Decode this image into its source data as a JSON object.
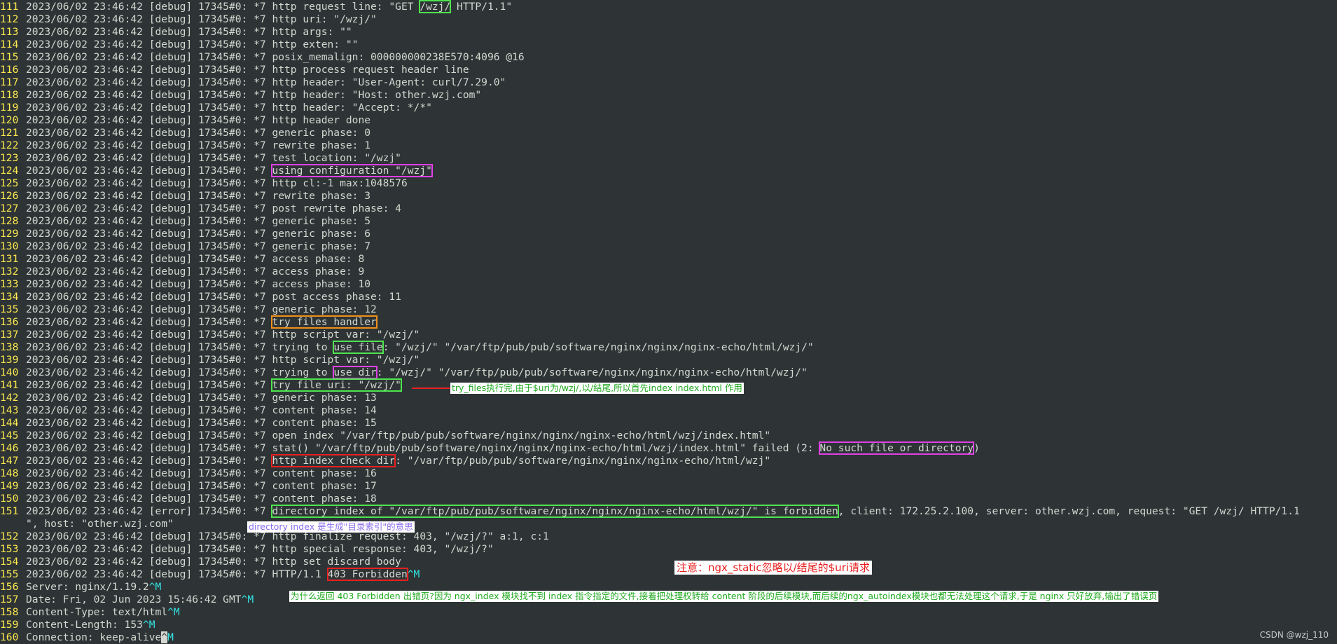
{
  "terminal": {
    "l111": {
      "num": "111",
      "a": "2023/06/02 23:46:42 [debug] 17345#0: *7 http request line: \"GET ",
      "b": "/wzj/",
      "c": " HTTP/1.1\""
    },
    "l112": {
      "num": "112",
      "text": "2023/06/02 23:46:42 [debug] 17345#0: *7 http uri: \"/wzj/\""
    },
    "l113": {
      "num": "113",
      "text": "2023/06/02 23:46:42 [debug] 17345#0: *7 http args: \"\""
    },
    "l114": {
      "num": "114",
      "text": "2023/06/02 23:46:42 [debug] 17345#0: *7 http exten: \"\""
    },
    "l115": {
      "num": "115",
      "text": "2023/06/02 23:46:42 [debug] 17345#0: *7 posix_memalign: 000000000238E570:4096 @16"
    },
    "l116": {
      "num": "116",
      "text": "2023/06/02 23:46:42 [debug] 17345#0: *7 http process request header line"
    },
    "l117": {
      "num": "117",
      "text": "2023/06/02 23:46:42 [debug] 17345#0: *7 http header: \"User-Agent: curl/7.29.0\""
    },
    "l118": {
      "num": "118",
      "text": "2023/06/02 23:46:42 [debug] 17345#0: *7 http header: \"Host: other.wzj.com\""
    },
    "l119": {
      "num": "119",
      "text": "2023/06/02 23:46:42 [debug] 17345#0: *7 http header: \"Accept: */*\""
    },
    "l120": {
      "num": "120",
      "text": "2023/06/02 23:46:42 [debug] 17345#0: *7 http header done"
    },
    "l121": {
      "num": "121",
      "text": "2023/06/02 23:46:42 [debug] 17345#0: *7 generic phase: 0"
    },
    "l122": {
      "num": "122",
      "text": "2023/06/02 23:46:42 [debug] 17345#0: *7 rewrite phase: 1"
    },
    "l123": {
      "num": "123",
      "text": "2023/06/02 23:46:42 [debug] 17345#0: *7 test location: \"/wzj\""
    },
    "l124": {
      "num": "124",
      "a": "2023/06/02 23:46:42 [debug] 17345#0: *7 ",
      "b": "using configuration \"/wzj\""
    },
    "l125": {
      "num": "125",
      "text": "2023/06/02 23:46:42 [debug] 17345#0: *7 http cl:-1 max:1048576"
    },
    "l126": {
      "num": "126",
      "text": "2023/06/02 23:46:42 [debug] 17345#0: *7 rewrite phase: 3"
    },
    "l127": {
      "num": "127",
      "text": "2023/06/02 23:46:42 [debug] 17345#0: *7 post rewrite phase: 4"
    },
    "l128": {
      "num": "128",
      "text": "2023/06/02 23:46:42 [debug] 17345#0: *7 generic phase: 5"
    },
    "l129": {
      "num": "129",
      "text": "2023/06/02 23:46:42 [debug] 17345#0: *7 generic phase: 6"
    },
    "l130": {
      "num": "130",
      "text": "2023/06/02 23:46:42 [debug] 17345#0: *7 generic phase: 7"
    },
    "l131": {
      "num": "131",
      "text": "2023/06/02 23:46:42 [debug] 17345#0: *7 access phase: 8"
    },
    "l132": {
      "num": "132",
      "text": "2023/06/02 23:46:42 [debug] 17345#0: *7 access phase: 9"
    },
    "l133": {
      "num": "133",
      "text": "2023/06/02 23:46:42 [debug] 17345#0: *7 access phase: 10"
    },
    "l134": {
      "num": "134",
      "text": "2023/06/02 23:46:42 [debug] 17345#0: *7 post access phase: 11"
    },
    "l135": {
      "num": "135",
      "text": "2023/06/02 23:46:42 [debug] 17345#0: *7 generic phase: 12"
    },
    "l136": {
      "num": "136",
      "a": "2023/06/02 23:46:42 [debug] 17345#0: *7 ",
      "b": "try files handler"
    },
    "l137": {
      "num": "137",
      "text": "2023/06/02 23:46:42 [debug] 17345#0: *7 http script var: \"/wzj/\""
    },
    "l138": {
      "num": "138",
      "a": "2023/06/02 23:46:42 [debug] 17345#0: *7 trying to ",
      "b": "use file",
      "c": ": \"/wzj/\" \"/var/ftp/pub/pub/software/nginx/nginx/nginx-echo/html/wzj/\""
    },
    "l139": {
      "num": "139",
      "text": "2023/06/02 23:46:42 [debug] 17345#0: *7 http script var: \"/wzj/\""
    },
    "l140": {
      "num": "140",
      "a": "2023/06/02 23:46:42 [debug] 17345#0: *7 trying to ",
      "b": "use dir",
      "c": ": \"/wzj/\" \"/var/ftp/pub/pub/software/nginx/nginx/nginx-echo/html/wzj/\""
    },
    "l141": {
      "num": "141",
      "a": "2023/06/02 23:46:42 [debug] 17345#0: *7 ",
      "b": "try file uri: \"/wzj/\""
    },
    "l142": {
      "num": "142",
      "text": "2023/06/02 23:46:42 [debug] 17345#0: *7 generic phase: 13"
    },
    "l143": {
      "num": "143",
      "text": "2023/06/02 23:46:42 [debug] 17345#0: *7 content phase: 14"
    },
    "l144": {
      "num": "144",
      "text": "2023/06/02 23:46:42 [debug] 17345#0: *7 content phase: 15"
    },
    "l145": {
      "num": "145",
      "text": "2023/06/02 23:46:42 [debug] 17345#0: *7 open index \"/var/ftp/pub/pub/software/nginx/nginx/nginx-echo/html/wzj/index.html\""
    },
    "l146": {
      "num": "146",
      "a": "2023/06/02 23:46:42 [debug] 17345#0: *7 stat() \"/var/ftp/pub/pub/software/nginx/nginx/nginx-echo/html/wzj/index.html\" failed (2: ",
      "b": "No such file or directory",
      "c": ")"
    },
    "l147": {
      "num": "147",
      "a": "2023/06/02 23:46:42 [debug] 17345#0: *7 ",
      "b": "http index check dir",
      "c": ": \"/var/ftp/pub/pub/software/nginx/nginx/nginx-echo/html/wzj\""
    },
    "l148": {
      "num": "148",
      "text": "2023/06/02 23:46:42 [debug] 17345#0: *7 content phase: 16"
    },
    "l149": {
      "num": "149",
      "text": "2023/06/02 23:46:42 [debug] 17345#0: *7 content phase: 17"
    },
    "l150": {
      "num": "150",
      "text": "2023/06/02 23:46:42 [debug] 17345#0: *7 content phase: 18"
    },
    "l151": {
      "num": "151",
      "a": "2023/06/02 23:46:42 [error] 17345#0: *7 ",
      "b": "directory index of \"/var/ftp/pub/pub/software/nginx/nginx/nginx-echo/html/wzj/\" is forbidden",
      "c": ", client: 172.25.2.100, server: other.wzj.com, request: \"GET /wzj/ HTTP/1.1",
      "d": "\", host: \"other.wzj.com\""
    },
    "l152": {
      "num": "152",
      "text": "2023/06/02 23:46:42 [debug] 17345#0: *7 http finalize request: 403, \"/wzj/?\" a:1, c:1"
    },
    "l153": {
      "num": "153",
      "text": "2023/06/02 23:46:42 [debug] 17345#0: *7 http special response: 403, \"/wzj/?\""
    },
    "l154": {
      "num": "154",
      "text": "2023/06/02 23:46:42 [debug] 17345#0: *7 http set discard body"
    },
    "l155": {
      "num": "155",
      "a": "2023/06/02 23:46:42 [debug] 17345#0: *7 HTTP/1.1 ",
      "b": "403 Forbidden",
      "c": "^M"
    },
    "l156": {
      "num": "156",
      "a": "Server: nginx/1.19.2",
      "c": "^M"
    },
    "l157": {
      "num": "157",
      "a": "Date: Fri, 02 Jun 2023 15:46:42 GMT",
      "c": "^M"
    },
    "l158": {
      "num": "158",
      "a": "Content-Type: text/html",
      "c": "^M"
    },
    "l159": {
      "num": "159",
      "a": "Content-Length: 153",
      "c": "^M"
    },
    "l160": {
      "num": "160",
      "a": "Connection: keep-alive",
      "cur": "^",
      "c": "M"
    }
  },
  "annotations": {
    "try_files_note": "try_files执行完,由于$uri为/wzj/,以/结尾,所以首先index index.html 作用",
    "directory_index_note": "directory index 是生成\"目录索引\"的意思",
    "ngx_static_note": "注意：ngx_static忽略以/结尾的$uri请求",
    "forbidden_reason_note": "为什么返回 403 Forbidden 出错页?因为 ngx_index 模块找不到 index 指令指定的文件,接着把处理权转给 content 阶段的后续模块,而后续的ngx_autoindex模块也都无法处理这个请求,于是 nginx 只好放弃,输出了错误页"
  },
  "watermark": "CSDN @wzj_110",
  "colors": {
    "background": "#2e3436",
    "text": "#d3d7cf",
    "line_number": "#fce94f",
    "highlight_green": "#4ee44e",
    "highlight_magenta": "#e040e8",
    "highlight_orange": "#f0901a",
    "highlight_red": "#e82020",
    "control_char": "#34e2e2"
  }
}
